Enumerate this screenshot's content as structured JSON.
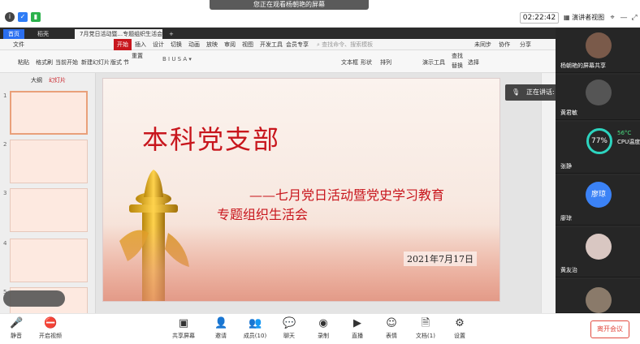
{
  "share_banner": "您正在观看杨朝艳的屏幕",
  "clock": "02:22:42",
  "view_mode": "演讲者视图",
  "wps": {
    "tabs": [
      "首页",
      "稻壳",
      "7月党日活动暨...专题组织生活会"
    ],
    "menus": [
      "文件",
      "开始",
      "插入",
      "设计",
      "切换",
      "动画",
      "放映",
      "审阅",
      "视图",
      "开发工具",
      "会员专享"
    ],
    "search_placeholder": "查找命令、搜索模板",
    "ribbon": [
      "粘贴",
      "格式刷",
      "当前开始",
      "新建幻灯片",
      "版式",
      "节",
      "重置",
      "文本框",
      "形状",
      "排列",
      "演示工具",
      "查找",
      "替换",
      "选择"
    ],
    "account": [
      "未同步",
      "协作",
      "分享"
    ],
    "pane_tabs": [
      "大纲",
      "幻灯片"
    ],
    "thumb_numbers": [
      "1",
      "2",
      "3",
      "4",
      "5"
    ]
  },
  "slide": {
    "title": "本科党支部",
    "subtitle_line1": "——七月党日活动暨党史学习教育",
    "subtitle_line2": "专题组织生活会",
    "date": "2021年7月17日"
  },
  "speaking": "正在讲话: 杨朝艳;",
  "participants": [
    {
      "name": "杨朝艳的屏幕共享",
      "color": "#7a5a4a"
    },
    {
      "name": "黄君敏",
      "color": "#555555"
    },
    {
      "name": "张静",
      "color": "#3a3a3a"
    },
    {
      "name": "廖琼",
      "color": "#3b82f6",
      "initials": "廖琼"
    },
    {
      "name": "黄友治",
      "color": "#d9c7c2"
    },
    {
      "name": "",
      "color": "#8a7a6a"
    }
  ],
  "cpu": {
    "percent": "77%",
    "temp": "56°C",
    "label": "CPU温度"
  },
  "bottombar": [
    {
      "label": "静音",
      "icon": "mic-icon"
    },
    {
      "label": "开启视频",
      "icon": "camera-off-icon"
    },
    {
      "label": "共享屏幕",
      "icon": "share-screen-icon"
    },
    {
      "label": "邀请",
      "icon": "invite-icon"
    },
    {
      "label": "成员(10)",
      "icon": "members-icon"
    },
    {
      "label": "聊天",
      "icon": "chat-icon"
    },
    {
      "label": "录制",
      "icon": "record-icon"
    },
    {
      "label": "直播",
      "icon": "live-icon"
    },
    {
      "label": "表情",
      "icon": "emoji-icon"
    },
    {
      "label": "文档(1)",
      "icon": "document-icon"
    },
    {
      "label": "设置",
      "icon": "gear-icon"
    }
  ],
  "leave": "离开会议"
}
